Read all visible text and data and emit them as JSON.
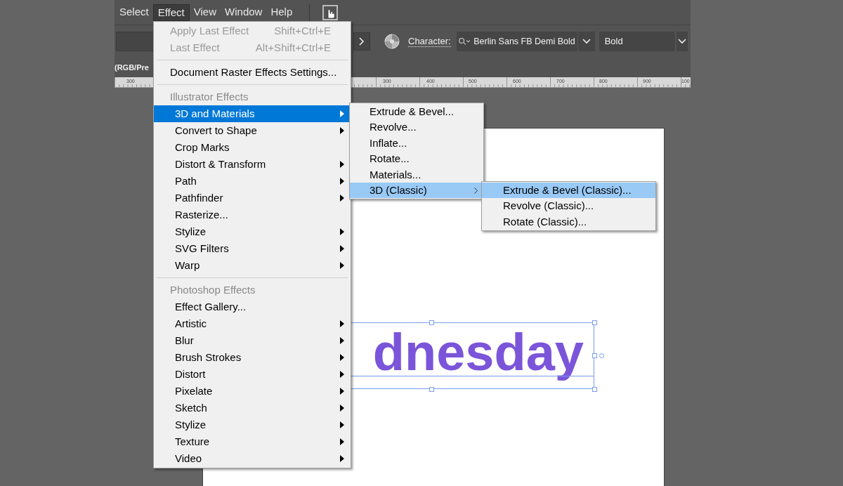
{
  "menu_bar": {
    "items": [
      {
        "label": "Select",
        "selected": false
      },
      {
        "label": "Effect",
        "selected": true
      },
      {
        "label": "View",
        "selected": false
      },
      {
        "label": "Window",
        "selected": false
      },
      {
        "label": "Help",
        "selected": false
      }
    ]
  },
  "toolbar": {
    "character_label": "Character:",
    "font_family": "Berlin Sans FB Demi Bold",
    "font_style": "Bold"
  },
  "document_tab": {
    "title": "(RGB/Pre"
  },
  "ruler": {
    "labels": [
      "300",
      "300",
      "400",
      "500",
      "600",
      "700",
      "800",
      "900",
      "100"
    ]
  },
  "canvas": {
    "text": "dnesday"
  },
  "effect_menu": {
    "sections": [
      {
        "items": [
          {
            "label": "Apply Last Effect",
            "shortcut": "Shift+Ctrl+E",
            "disabled": true,
            "has_submenu": false,
            "selected": false
          },
          {
            "label": "Last Effect",
            "shortcut": "Alt+Shift+Ctrl+E",
            "disabled": true,
            "has_submenu": false,
            "selected": false
          }
        ]
      },
      {
        "items": [
          {
            "label": "Document Raster Effects Settings...",
            "disabled": false,
            "has_submenu": false,
            "selected": false
          }
        ]
      },
      {
        "header": "Illustrator Effects",
        "items": [
          {
            "label": "3D and Materials",
            "disabled": false,
            "has_submenu": true,
            "selected": true
          },
          {
            "label": "Convert to Shape",
            "disabled": false,
            "has_submenu": true,
            "selected": false
          },
          {
            "label": "Crop Marks",
            "disabled": false,
            "has_submenu": false,
            "selected": false
          },
          {
            "label": "Distort & Transform",
            "disabled": false,
            "has_submenu": true,
            "selected": false
          },
          {
            "label": "Path",
            "disabled": false,
            "has_submenu": true,
            "selected": false
          },
          {
            "label": "Pathfinder",
            "disabled": false,
            "has_submenu": true,
            "selected": false
          },
          {
            "label": "Rasterize...",
            "disabled": false,
            "has_submenu": false,
            "selected": false
          },
          {
            "label": "Stylize",
            "disabled": false,
            "has_submenu": true,
            "selected": false
          },
          {
            "label": "SVG Filters",
            "disabled": false,
            "has_submenu": true,
            "selected": false
          },
          {
            "label": "Warp",
            "disabled": false,
            "has_submenu": true,
            "selected": false
          }
        ]
      },
      {
        "header": "Photoshop Effects",
        "items": [
          {
            "label": "Effect Gallery...",
            "disabled": false,
            "has_submenu": false,
            "selected": false
          },
          {
            "label": "Artistic",
            "disabled": false,
            "has_submenu": true,
            "selected": false
          },
          {
            "label": "Blur",
            "disabled": false,
            "has_submenu": true,
            "selected": false
          },
          {
            "label": "Brush Strokes",
            "disabled": false,
            "has_submenu": true,
            "selected": false
          },
          {
            "label": "Distort",
            "disabled": false,
            "has_submenu": true,
            "selected": false
          },
          {
            "label": "Pixelate",
            "disabled": false,
            "has_submenu": true,
            "selected": false
          },
          {
            "label": "Sketch",
            "disabled": false,
            "has_submenu": true,
            "selected": false
          },
          {
            "label": "Stylize",
            "disabled": false,
            "has_submenu": true,
            "selected": false
          },
          {
            "label": "Texture",
            "disabled": false,
            "has_submenu": true,
            "selected": false
          },
          {
            "label": "Video",
            "disabled": false,
            "has_submenu": true,
            "selected": false
          }
        ]
      }
    ]
  },
  "materials_submenu": {
    "items": [
      {
        "label": "Extrude & Bevel...",
        "has_submenu": false,
        "selected": false
      },
      {
        "label": "Revolve...",
        "has_submenu": false,
        "selected": false
      },
      {
        "label": "Inflate...",
        "has_submenu": false,
        "selected": false
      },
      {
        "label": "Rotate...",
        "has_submenu": false,
        "selected": false
      },
      {
        "label": "Materials...",
        "has_submenu": false,
        "selected": false
      },
      {
        "label": "3D (Classic)",
        "has_submenu": true,
        "selected": true
      }
    ]
  },
  "classic_submenu": {
    "items": [
      {
        "label": "Extrude & Bevel (Classic)...",
        "selected": true
      },
      {
        "label": "Revolve (Classic)...",
        "selected": false
      },
      {
        "label": "Rotate (Classic)...",
        "selected": false
      }
    ]
  }
}
